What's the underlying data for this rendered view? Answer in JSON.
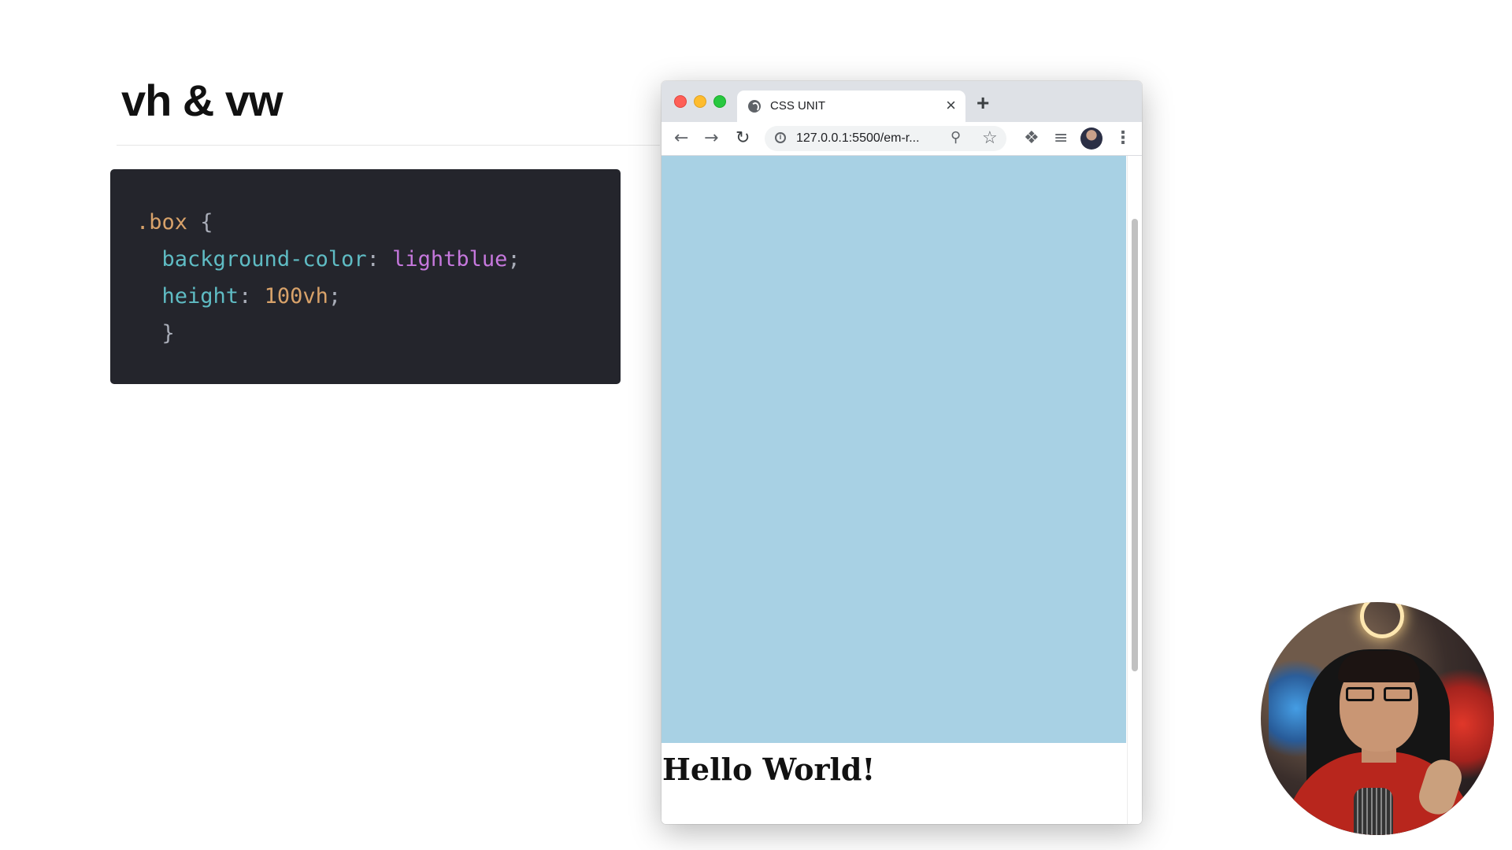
{
  "slide": {
    "title": "vh & vw"
  },
  "code": {
    "line1": {
      "selector": ".box",
      "brace": " {"
    },
    "line2": {
      "indent": "  ",
      "property": "background-color",
      "colon": ": ",
      "value": "lightblue",
      "semi": ";"
    },
    "line3": {
      "indent": "  ",
      "property": "height",
      "colon": ": ",
      "value": "100vh",
      "semi": ";"
    },
    "line4": {
      "indent": "  ",
      "brace": "}"
    }
  },
  "browser": {
    "tab_title": "CSS UNIT",
    "tab_close": "×",
    "new_tab": "+",
    "url": "127.0.0.1:5500/em-r...",
    "icons": {
      "back": "arrow-left",
      "forward": "arrow-right",
      "reload": "reload",
      "info": "info",
      "zoom": "magnifier",
      "bookmark": "star",
      "extensions": "puzzle",
      "media": "media-queue",
      "menu": "kebab"
    },
    "content": {
      "box_color": "#a8d1e4",
      "heading": "Hello World!"
    }
  },
  "colors": {
    "code_bg": "#24252c",
    "selector": "#d8a26a",
    "property": "#5fbcc4",
    "keyword_value": "#c678dd",
    "number_value": "#d8a26a"
  }
}
